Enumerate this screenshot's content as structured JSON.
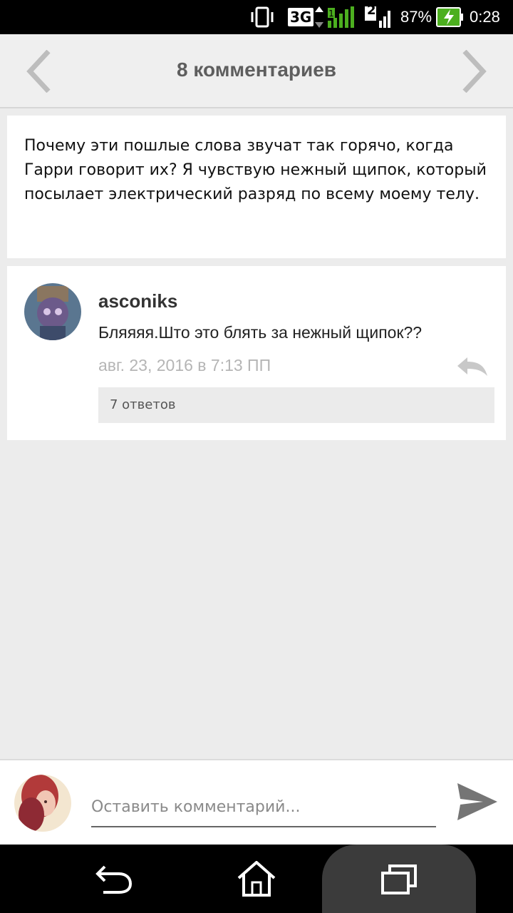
{
  "status_bar": {
    "network": "3G",
    "sim2": "2",
    "battery_percent": "87%",
    "time": "0:28"
  },
  "header": {
    "title": "8 комментариев"
  },
  "post": {
    "text": "Почему эти пошлые слова звучат так горячо, когда Гарри говорит их? Я чувствую нежный щипок, который посылает электрический разряд по всему моему телу."
  },
  "comment": {
    "username": "asconiks",
    "text": "Бляяяя.Што это блять за нежный щипок??",
    "date": "авг. 23, 2016 в 7:13 ПП",
    "replies_label": "7 ответов"
  },
  "composer": {
    "placeholder": "Оставить комментарий..."
  },
  "colors": {
    "accent_green": "#4caf1f",
    "header_bg": "#efefef",
    "page_bg": "#ececec"
  }
}
